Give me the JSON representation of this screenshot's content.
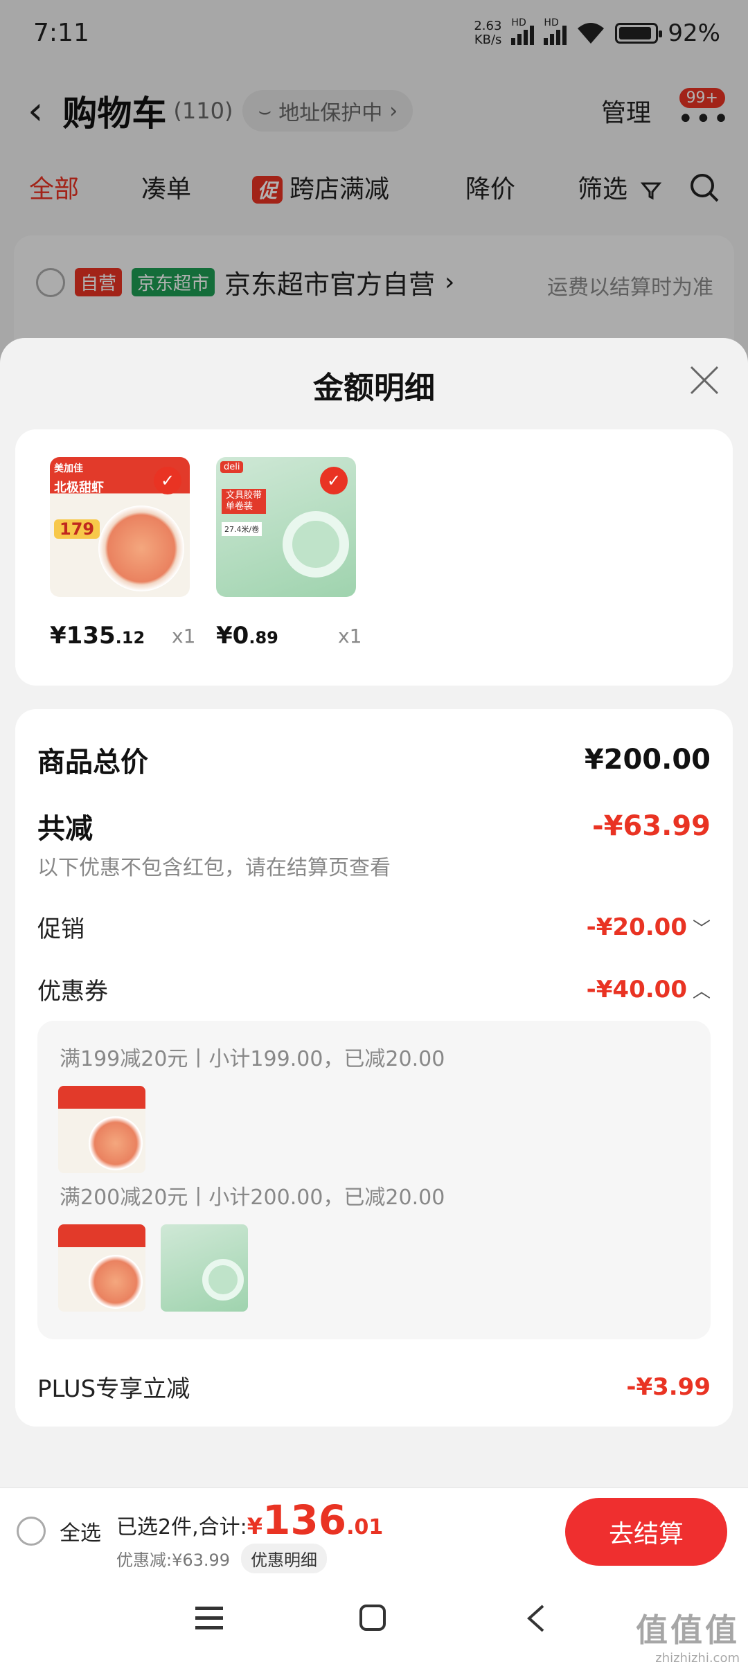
{
  "status_bar": {
    "time": "7:11",
    "net_speed_value": "2.63",
    "net_speed_unit": "KB/s",
    "battery": "92%",
    "battery_level": 0.92
  },
  "header": {
    "title": "购物车",
    "count": "(110)",
    "address_label": "地址保护中",
    "manage_label": "管理",
    "badge": "99+"
  },
  "filter_tabs": {
    "all": "全部",
    "bundle": "凑单",
    "promo_tag": "促",
    "cross_store": "跨店满减",
    "price_drop": "降价",
    "filter": "筛选"
  },
  "store": {
    "tag_self": "自营",
    "tag_jd": "京东超市",
    "name": "京东超市官方自营",
    "shipping_note": "运费以结算时为准"
  },
  "sheet": {
    "title": "金额明细",
    "items": [
      {
        "price_int": "¥135",
        "price_dec": ".12",
        "qty": "x1"
      },
      {
        "price_int": "¥0",
        "price_dec": ".89",
        "qty": "x1"
      }
    ],
    "product1_thumb": {
      "brand": "美加佳",
      "text1": "北极甜虾",
      "price": "179"
    },
    "product2_thumb": {
      "brand": "deli",
      "text1": "文具胶带",
      "text2": "单卷装",
      "text3": "27.4米/卷"
    },
    "summary": {
      "total_label": "商品总价",
      "total_value": "¥200.00",
      "reduce_label": "共减",
      "reduce_value": "-¥63.99",
      "reduce_note": "以下优惠不包含红包，请在结算页查看",
      "promo_label": "促销",
      "promo_value": "-¥20.00",
      "coupon_label": "优惠券",
      "coupon_value": "-¥40.00",
      "coupon1_desc": "满199减20元丨小计199.00，已减20.00",
      "coupon2_desc": "满200减20元丨小计200.00，已减20.00",
      "plus_label": "PLUS专享立减",
      "plus_value": "-¥3.99"
    }
  },
  "bottom_bar": {
    "select_all": "全选",
    "selected_text": "已选2件,合计:",
    "yen": "¥",
    "total_int": "136",
    "total_dec": ".01",
    "discount_text": "优惠减:¥63.99",
    "detail_button": "优惠明细",
    "checkout_button": "去结算"
  },
  "watermark": {
    "big": "值值值",
    "small": "zhizhizhi.com"
  },
  "colors": {
    "accent": "#e93323",
    "jd_green": "#1d9d53"
  }
}
